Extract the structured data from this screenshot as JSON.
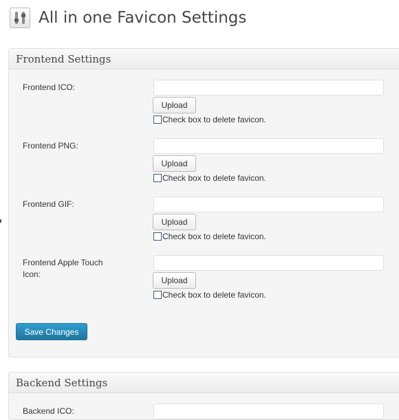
{
  "page": {
    "title": "All in one Favicon Settings",
    "icon": "settings-sliders-icon"
  },
  "frontend": {
    "heading": "Frontend Settings",
    "fields": [
      {
        "label": "Frontend ICO:",
        "value": "",
        "button": "Upload",
        "delete_label": "Check box to delete favicon."
      },
      {
        "label": "Frontend PNG:",
        "value": "",
        "button": "Upload",
        "delete_label": "Check box to delete favicon."
      },
      {
        "label": "Frontend GIF:",
        "value": "",
        "button": "Upload",
        "delete_label": "Check box to delete favicon."
      },
      {
        "label": "Frontend Apple Touch Icon:",
        "value": "",
        "button": "Upload",
        "delete_label": "Check box to delete favicon."
      }
    ],
    "save_label": "Save Changes"
  },
  "backend": {
    "heading": "Backend Settings",
    "fields": [
      {
        "label": "Backend ICO:",
        "value": ""
      }
    ]
  },
  "colors": {
    "accent": "#21759b",
    "panel_bg": "#f5f5f5",
    "border": "#dfdfdf"
  }
}
